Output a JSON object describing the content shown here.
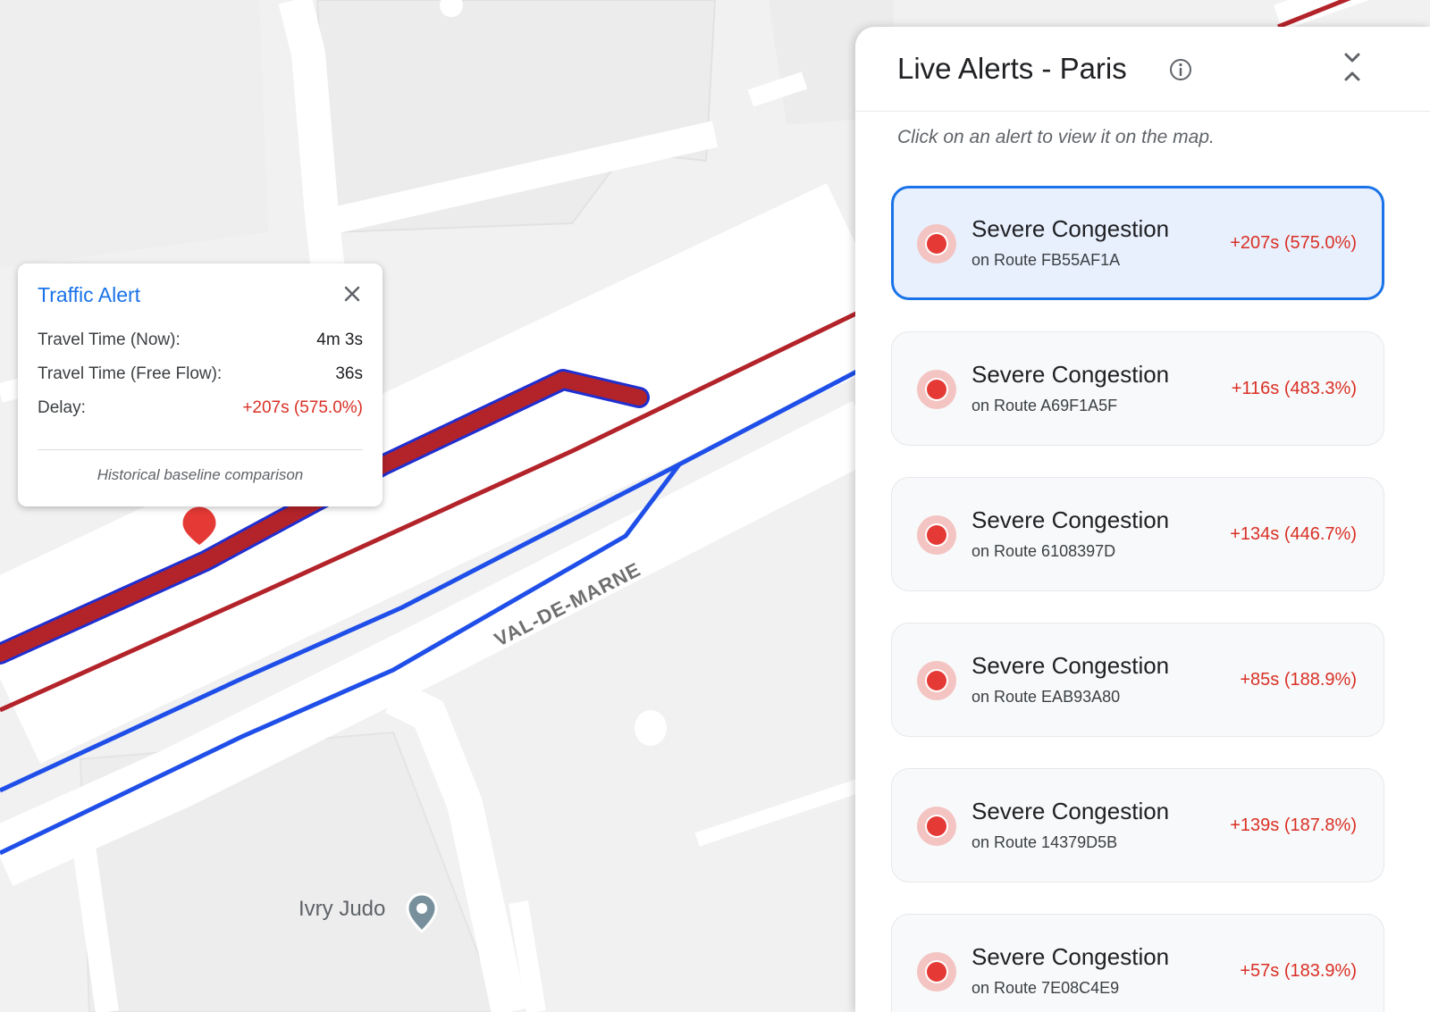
{
  "map": {
    "area_label": "VAL-DE-MARNE",
    "poi_label": "Ivry Judo",
    "colors": {
      "background": "#f1f1f1",
      "road": "#ffffff",
      "route_blue": "#1f4fe8",
      "route_red": "#b3232a",
      "congestion": "#b3232a"
    }
  },
  "info_window": {
    "title": "Traffic Alert",
    "rows": [
      {
        "label": "Travel Time (Now):",
        "value": "4m 3s"
      },
      {
        "label": "Travel Time (Free Flow):",
        "value": "36s"
      },
      {
        "label": "Delay:",
        "value": "+207s (575.0%)"
      }
    ],
    "note": "Historical baseline comparison"
  },
  "panel": {
    "title": "Live Alerts - Paris",
    "hint": "Click on an alert to view it on the map.",
    "alerts": [
      {
        "title": "Severe Congestion",
        "route": "on Route FB55AF1A",
        "delay": "+207s (575.0%)",
        "selected": true
      },
      {
        "title": "Severe Congestion",
        "route": "on Route A69F1A5F",
        "delay": "+116s (483.3%)"
      },
      {
        "title": "Severe Congestion",
        "route": "on Route 6108397D",
        "delay": "+134s (446.7%)"
      },
      {
        "title": "Severe Congestion",
        "route": "on Route EAB93A80",
        "delay": "+85s (188.9%)"
      },
      {
        "title": "Severe Congestion",
        "route": "on Route 14379D5B",
        "delay": "+139s (187.8%)"
      },
      {
        "title": "Severe Congestion",
        "route": "on Route 7E08C4E9",
        "delay": "+57s (183.9%)"
      }
    ],
    "colors": {
      "accent": "#1a73e8",
      "delay": "#d93025",
      "selected_bg": "#e8f0fe"
    }
  }
}
